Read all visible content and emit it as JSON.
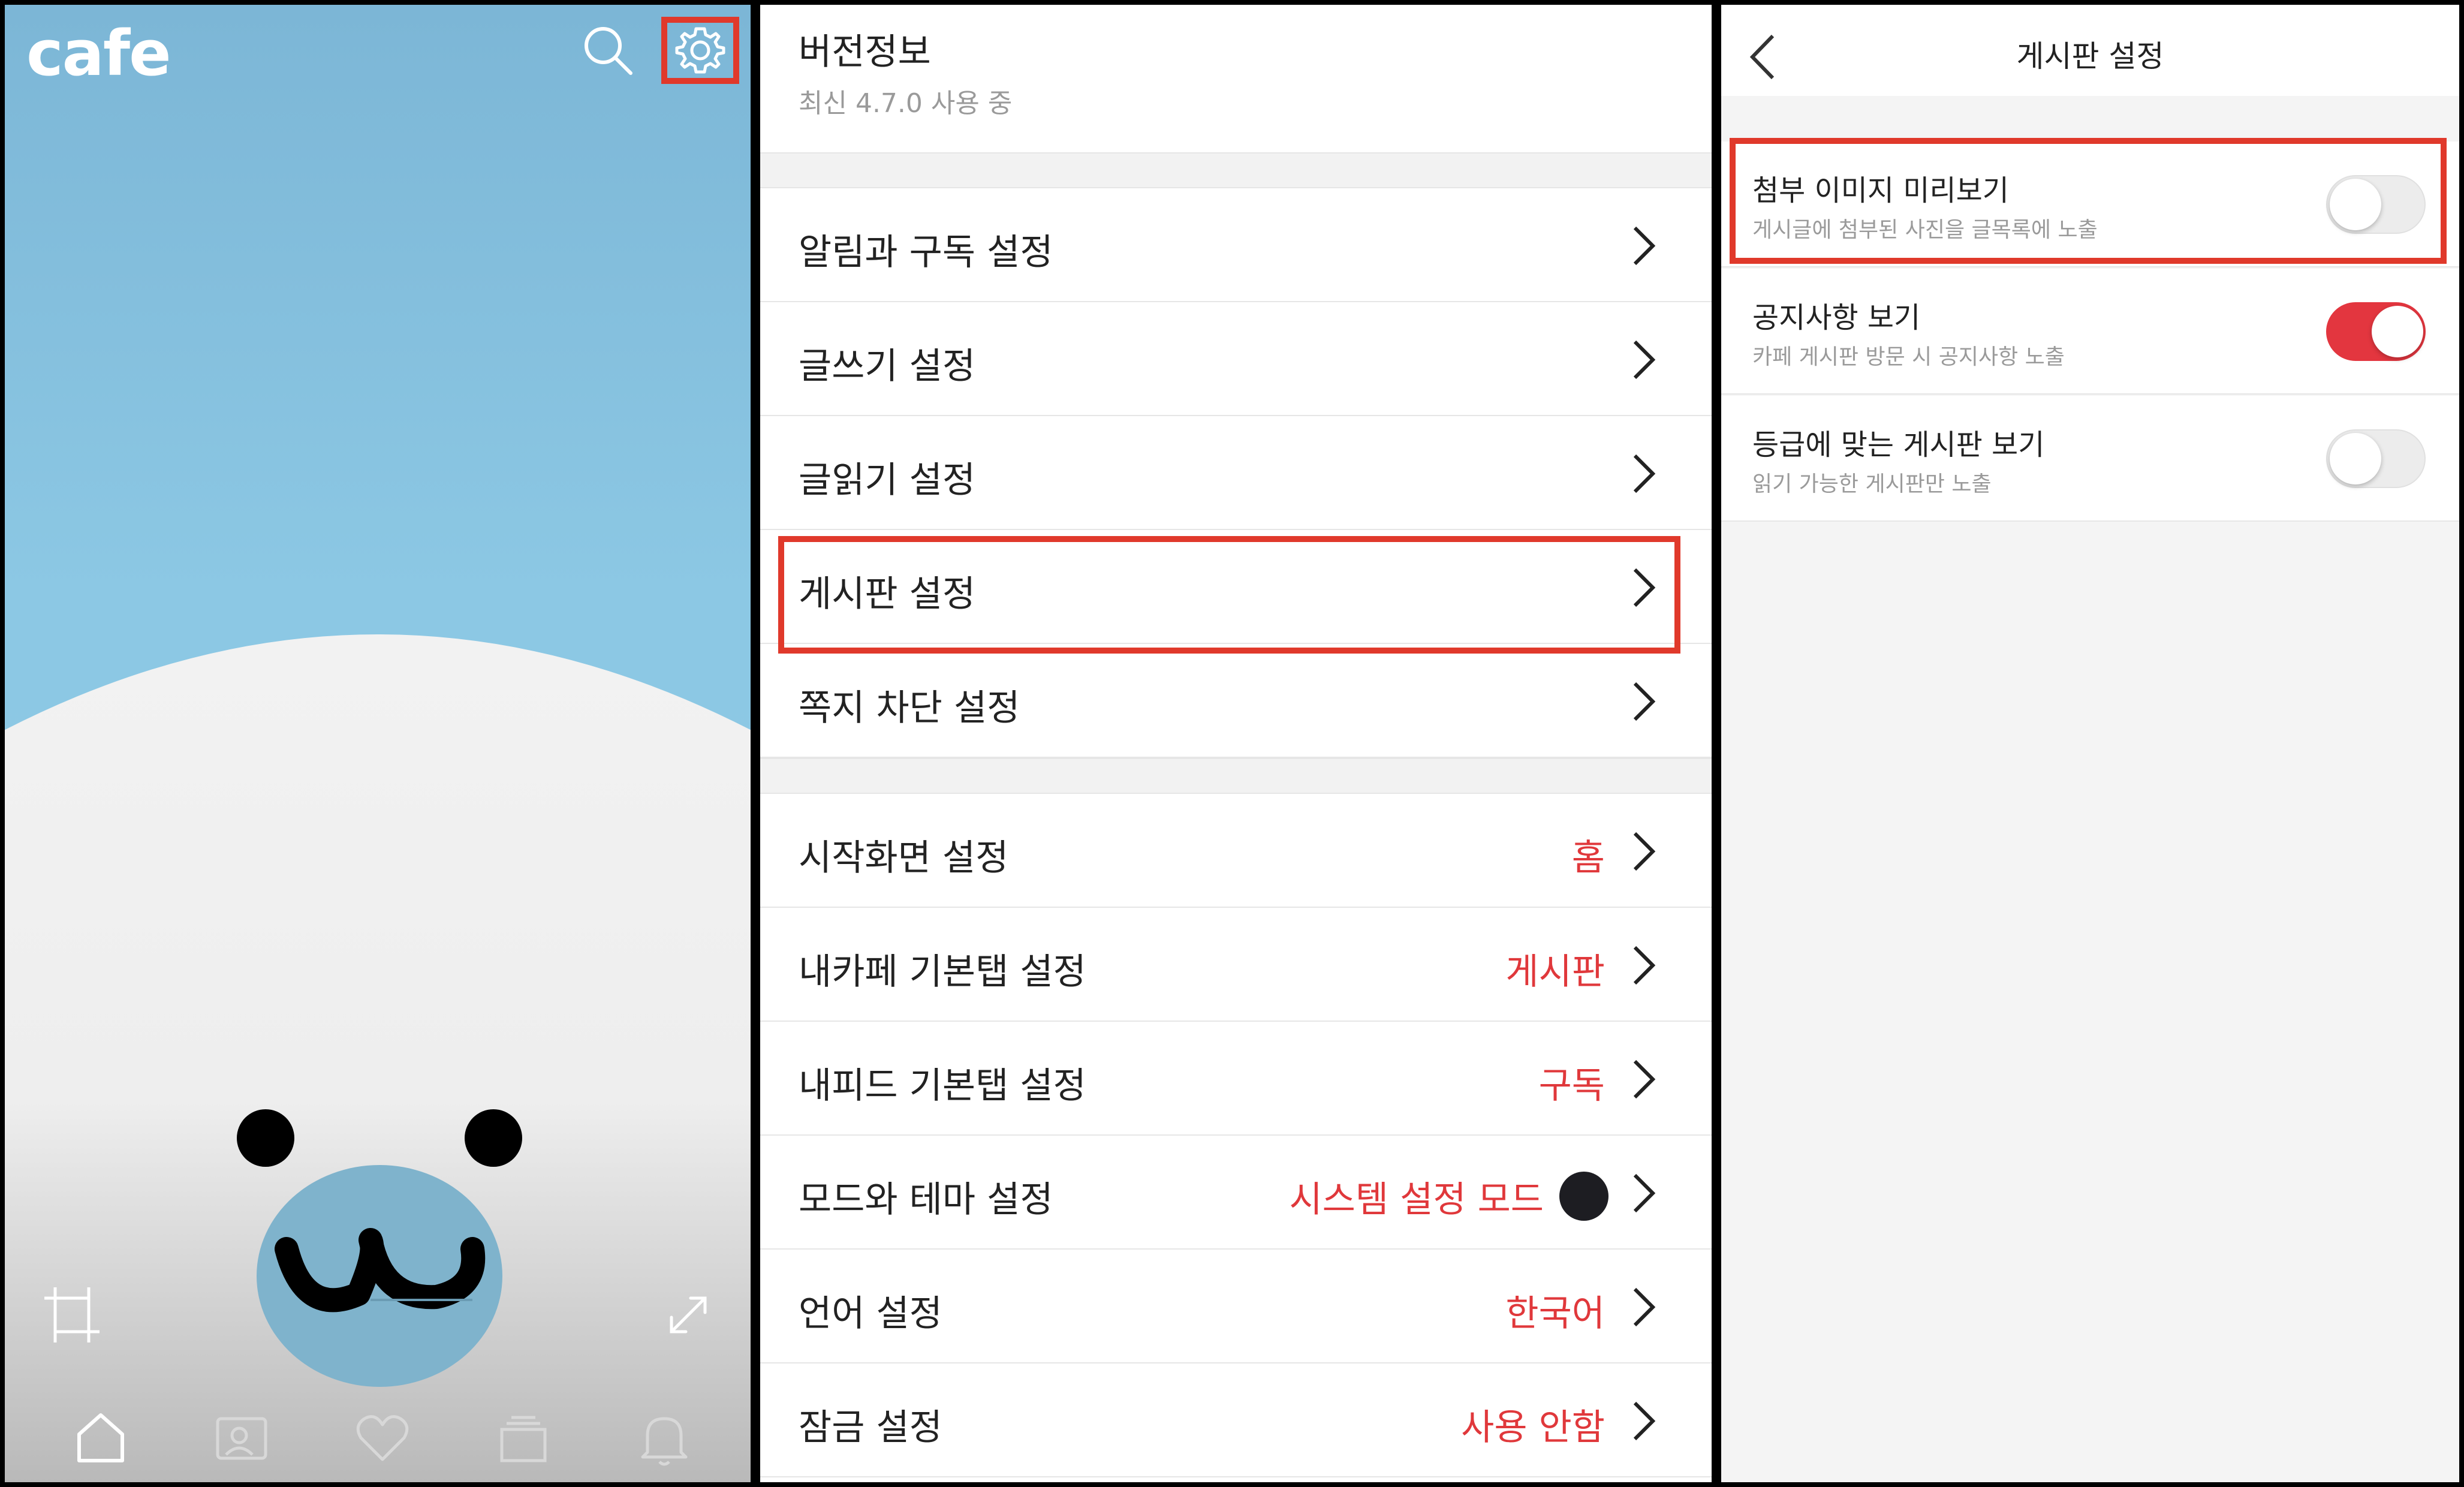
{
  "cafe": {
    "logo": "cafe",
    "icons": {
      "search": "search-icon",
      "settings": "gear-icon",
      "crop": "crop-icon",
      "expand": "expand-icon"
    },
    "bottom_nav": [
      "home-icon",
      "profile-card-icon",
      "heart-icon",
      "feed-icon",
      "bell-icon"
    ]
  },
  "settings": {
    "version": {
      "title": "버전정보",
      "subtitle": "최신 4.7.0 사용 중"
    },
    "group1": [
      {
        "label": "알림과 구독 설정"
      },
      {
        "label": "글쓰기 설정"
      },
      {
        "label": "글읽기 설정"
      },
      {
        "label": "게시판 설정"
      },
      {
        "label": "쪽지 차단 설정"
      }
    ],
    "group2": [
      {
        "label": "시작화면 설정",
        "value": "홈"
      },
      {
        "label": "내카페 기본탭 설정",
        "value": "게시판"
      },
      {
        "label": "내피드 기본탭 설정",
        "value": "구독"
      },
      {
        "label": "모드와 테마 설정",
        "value": "시스템 설정 모드"
      },
      {
        "label": "언어 설정",
        "value": "한국어"
      },
      {
        "label": "잠금 설정",
        "value": "사용 안함"
      }
    ]
  },
  "board": {
    "title": "게시판 설정",
    "options": [
      {
        "label": "첨부 이미지 미리보기",
        "desc": "게시글에 첨부된 사진을 글목록에 노출",
        "enabled": false
      },
      {
        "label": "공지사항 보기",
        "desc": "카페 게시판 방문 시 공지사항 노출",
        "enabled": true
      },
      {
        "label": "등급에 맞는 게시판 보기",
        "desc": "읽기 가능한 게시판만 노출",
        "enabled": false
      }
    ]
  },
  "colors": {
    "accent_red": "#e3363f",
    "highlight_box": "#e0392b",
    "sky": "#8cc8e4",
    "seal_body": "#f2f2f2",
    "seal_nose": "#7fb3cc"
  }
}
